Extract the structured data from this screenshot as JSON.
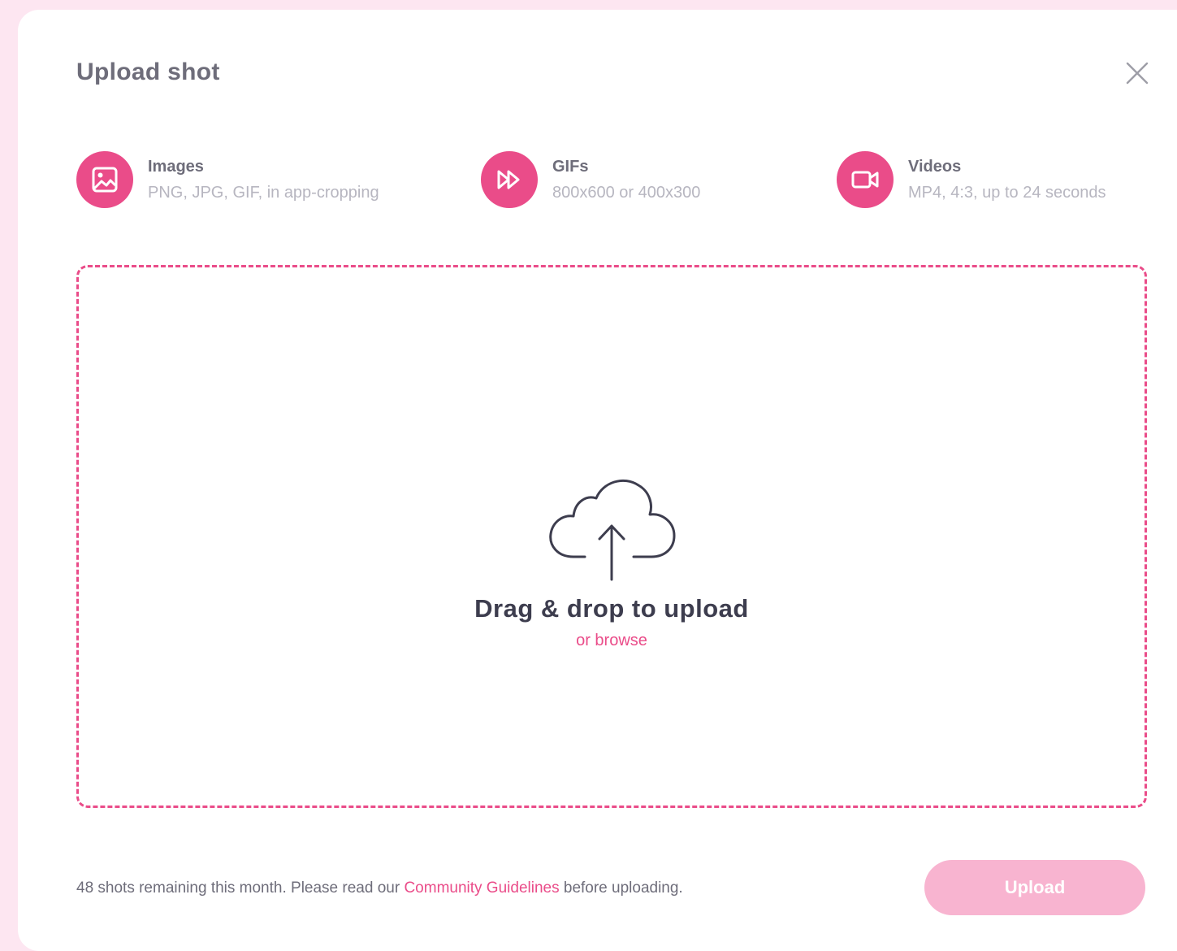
{
  "modal": {
    "title": "Upload shot",
    "close_icon": "close-icon"
  },
  "types": [
    {
      "name": "Images",
      "description": "PNG, JPG, GIF, in app-cropping",
      "icon": "image-icon"
    },
    {
      "name": "GIFs",
      "description": "800x600 or 400x300",
      "icon": "fast-forward-icon"
    },
    {
      "name": "Videos",
      "description": "MP4, 4:3, up to 24 seconds",
      "icon": "video-camera-icon"
    }
  ],
  "dropzone": {
    "icon": "cloud-upload-icon",
    "title": "Drag & drop to upload",
    "browse_label": "or browse"
  },
  "footer": {
    "note_before": "48 shots remaining this month. Please read our ",
    "guidelines_link": "Community Guidelines",
    "note_after": " before uploading.",
    "upload_label": "Upload"
  },
  "colors": {
    "accent": "#ea4c89",
    "accent_disabled": "#f8b4d0",
    "backdrop": "#fde6f1",
    "title_text": "#6e6d7a",
    "muted_text": "#b7b6c0",
    "heading_text": "#3d3d4e"
  }
}
